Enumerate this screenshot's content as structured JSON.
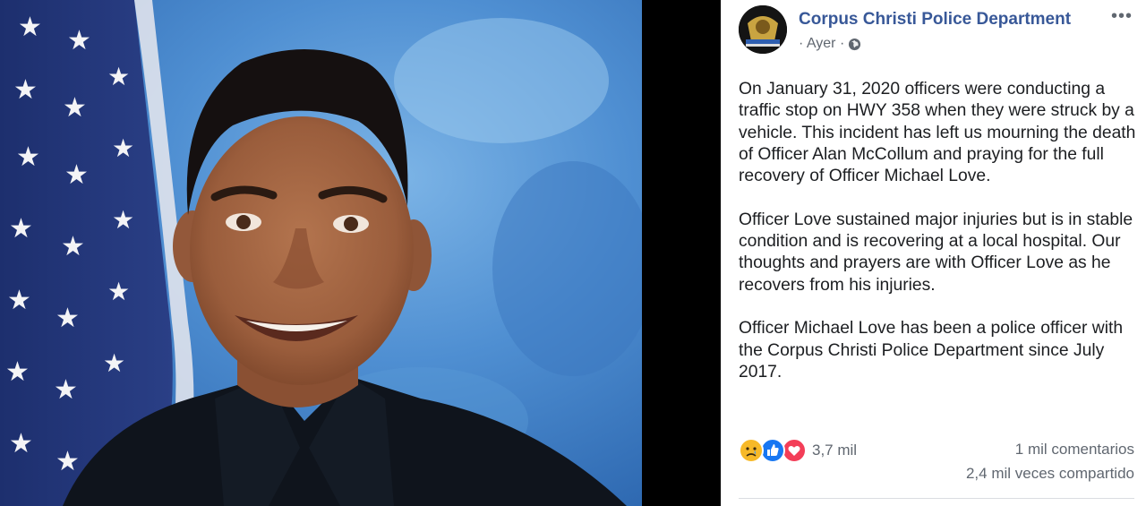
{
  "post": {
    "page_name": "Corpus Christi Police Department",
    "time": "· Ayer ·",
    "privacy_icon": "globe-icon",
    "more_label": "•••",
    "paragraphs": [
      "On January 31, 2020 officers were conducting a traffic stop on HWY 358 when they were struck by a vehicle. This incident has left us mourning the death of Officer Alan McCollum and praying for the full recovery of Officer Michael Love.",
      "Officer Love sustained major injuries but is in stable condition and is recovering at a local hospital. Our thoughts and prayers are with Officer Love as he recovers from his injuries.",
      "Officer Michael Love has been a police officer with the Corpus Christi Police Department since July 2017."
    ]
  },
  "footer": {
    "reaction_icons": [
      "sad-reaction-icon",
      "like-reaction-icon",
      "love-reaction-icon"
    ],
    "reaction_count": "3,7 mil",
    "comments": "1 mil comentarios",
    "shares": "2,4 mil veces compartido"
  },
  "colors": {
    "link_blue": "#385898",
    "like_blue": "#1877f2",
    "love_red": "#f33e58",
    "sad_yellow": "#f7b928",
    "secondary_text": "#606770"
  }
}
